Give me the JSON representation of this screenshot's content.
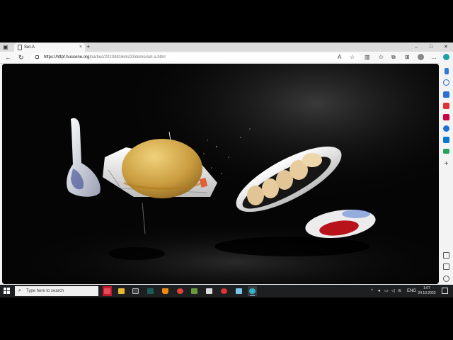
{
  "browser": {
    "tab_title": "Set-A",
    "new_tab_symbol": "+",
    "close_tab_symbol": "×",
    "url_host": "https://httpf.huscene.org",
    "url_path": "/parties/2023/td16ms00/demo/set-a.html",
    "window_controls": {
      "minimize": "–",
      "maximize": "□",
      "close": "✕"
    }
  },
  "taskbar": {
    "search_placeholder": "Type here to search",
    "language": "ENG",
    "time": "1:07",
    "date": "24.10.2023",
    "apps": [
      "vivaldi-red-app",
      "file-explorer",
      "terminal",
      "vectorworks-v",
      "vlc",
      "chrome",
      "other-app",
      "games-app",
      "recorder",
      "notepad",
      "edge"
    ]
  },
  "scene": {
    "description_items": [
      "spoon",
      "fried-rice-plate",
      "dumplings-plate",
      "sauce-dish"
    ],
    "colors": {
      "background": "#050505",
      "plate": "#f2f2f2",
      "rice": "#d8b55a",
      "dumpling": "#e3c99a",
      "sauce": "#c0141a"
    }
  }
}
